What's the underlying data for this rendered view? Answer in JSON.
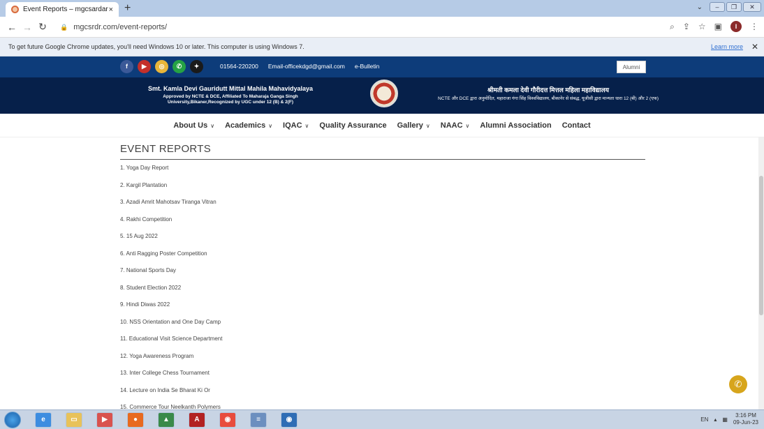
{
  "browser": {
    "tab_title": "Event Reports – mgcsardar",
    "tab_close": "×",
    "new_tab": "+",
    "url": "mgcsrdr.com/event-reports/",
    "infobar_text": "To get future Google Chrome updates, you'll need Windows 10 or later. This computer is using Windows 7.",
    "learn_more": "Learn more",
    "close": "✕",
    "profile_initial": "I"
  },
  "site": {
    "phone": "01564-220200",
    "email": "Email-officekdgd@gmail.com",
    "bulletin": "e-Bulletin",
    "alumni_button": "Alumni",
    "college_name_en": "Smt. Kamla Devi Gauridutt Mittal Mahila Mahavidyalaya",
    "college_sub_en": "Approved by NCTE & DCE, Affiliated To Maharaja Ganga Singh University,Bikaner,Recognized by UGC under 12 (B) & 2(F)",
    "college_name_hi": "श्रीमती कमला देवी गौरीदत्त मित्तल महिला महाविद्यालय",
    "college_sub_hi": "NCTE और DCE द्वारा अनुमोदित, महाराजा गंगा सिंह विश्वविद्यालय, बीकानेर से संबद्ध, यूजीसी द्वारा मान्यता धारा 12 (बी) और 2 (एफ)",
    "nav": [
      "About Us",
      "Academics",
      "IQAC",
      "Quality Assurance",
      "Gallery",
      "NAAC",
      "Alumni Association",
      "Contact"
    ]
  },
  "page": {
    "title": "EVENT REPORTS",
    "reports": [
      "1. Yoga Day Report",
      "2. Kargil Plantation",
      "3. Azadi Amrit Mahotsav Tiranga Vitran",
      "4. Rakhi Competition",
      "5. 15 Aug 2022",
      "6. Anti Ragging Poster Competition",
      "7. National Sports Day",
      "8. Student Election 2022",
      "9. Hindi Diwas 2022",
      "10. NSS Orientation and One Day Camp",
      "11. Educational Visit Science Department",
      "12. Yoga Awareness Program",
      "13. Inter College Chess Tournament",
      "14. Lecture on India Se Bharat Ki Or",
      "15. Commerce Tour Neelkanth Polymers"
    ]
  },
  "taskbar": {
    "lang": "EN",
    "time": "3:16 PM",
    "date": "09-Jun-23"
  }
}
